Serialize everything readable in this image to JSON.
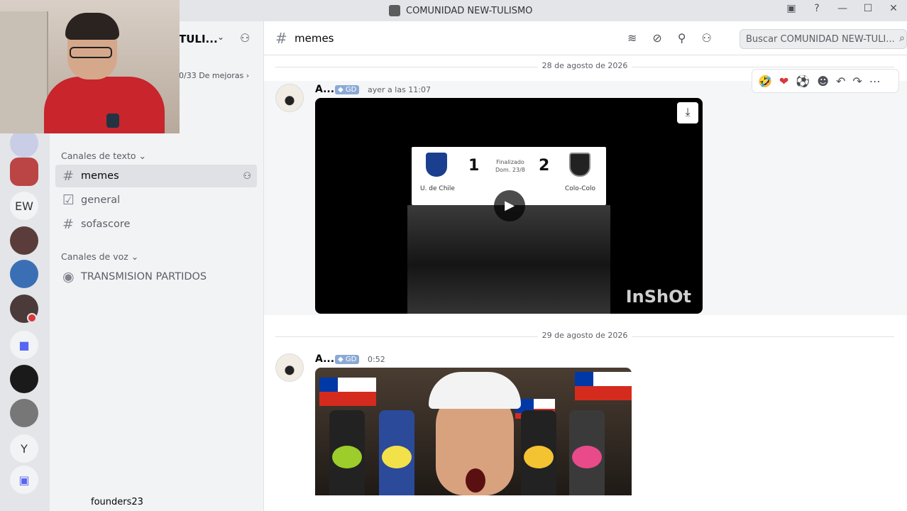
{
  "window": {
    "title": "COMUNIDAD NEW-TULISMO",
    "controls": [
      "▣",
      "?",
      "—",
      "☐",
      "✕"
    ]
  },
  "rail": {
    "letters": [
      "EW",
      "Y"
    ]
  },
  "sidebar": {
    "guild_name": "TULI...",
    "boost_text": "0/33 De mejoras",
    "text_category": "Canales de texto",
    "voice_category": "Canales de voz",
    "channels": [
      {
        "name": "memes",
        "icon": "hash-icon"
      },
      {
        "name": "general",
        "icon": "rules-icon"
      },
      {
        "name": "sofascore",
        "icon": "hash-icon"
      }
    ],
    "voice_channels": [
      {
        "name": "TRANSMISION PARTIDOS",
        "icon": "stage-icon"
      }
    ],
    "user": "founders23"
  },
  "header": {
    "channel_name": "memes",
    "search_placeholder": "Buscar COMUNIDAD NEW-TULI..."
  },
  "messages": [
    {
      "date": "28 de agosto de 2026",
      "author": "A...",
      "tag": "GD",
      "time": "ayer a las 11:07",
      "video": {
        "team_home": "U. de Chile",
        "team_away": "Colo-Colo",
        "score_home": "1",
        "score_away": "2",
        "status": "Finalizado",
        "match_date": "Dom. 23/8",
        "watermark": "InShOt"
      }
    },
    {
      "date": "29 de agosto de 2026",
      "author": "A...",
      "tag": "GD",
      "time": "0:52"
    }
  ],
  "reactions": [
    "🤣",
    "❤",
    "⚽",
    "☻",
    "↶",
    "↷",
    "⋯"
  ],
  "colors": {
    "accent": "#5865f2",
    "chile_red": "#d52b1e",
    "chile_blue": "#0039a6"
  }
}
